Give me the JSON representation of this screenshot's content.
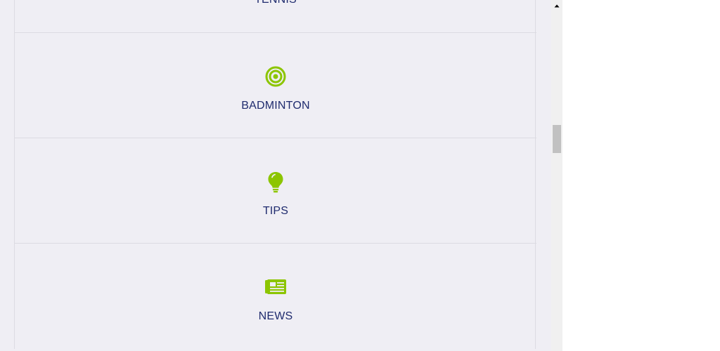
{
  "menu": {
    "items": [
      {
        "label": "TENNIS",
        "icon": "tennis-icon"
      },
      {
        "label": "BADMINTON",
        "icon": "target-icon"
      },
      {
        "label": "TIPS",
        "icon": "lightbulb-icon"
      },
      {
        "label": "NEWS",
        "icon": "newspaper-icon"
      }
    ]
  },
  "colors": {
    "page_background": "#efeef4",
    "icon_accent": "#8cc500",
    "label_text": "#1f2b6e",
    "divider": "#dcdbe2",
    "scrollbar_track": "#f0f0f0",
    "scrollbar_thumb": "#c1c1c1"
  }
}
